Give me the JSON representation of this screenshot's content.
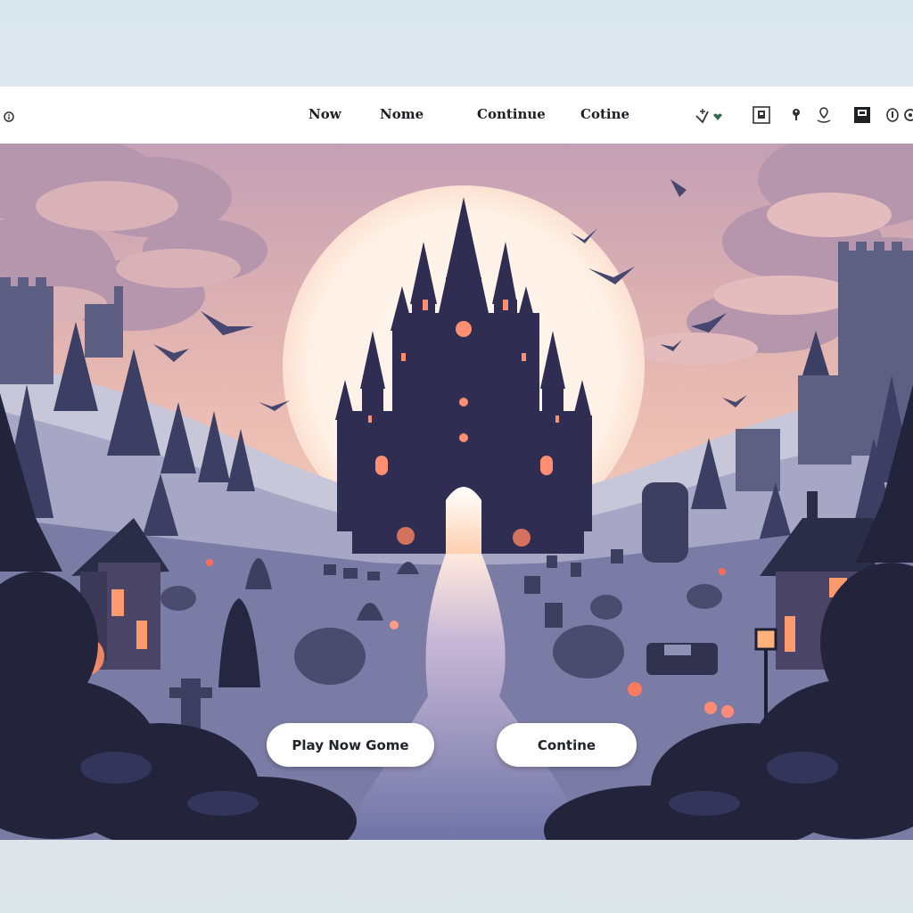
{
  "nav": {
    "items": [
      {
        "label": "Now"
      },
      {
        "label": "Nome"
      },
      {
        "label": "Continue"
      },
      {
        "label": "Cotine"
      }
    ]
  },
  "toolbar": {
    "icons": [
      "info-icon",
      "heart-check-icon",
      "book-icon",
      "pin-icon",
      "location-icon",
      "save-icon",
      "help-icon",
      "settings-icon"
    ]
  },
  "scene": {
    "theme_colors": {
      "sky_top": "#c9a3b0",
      "sky_glow": "#f7cfb6",
      "moon": "#fff4ec",
      "castle": "#2c2b4d",
      "window_glow": "#ff8a6a",
      "ground": "#6e6f95",
      "foreground": "#22233a"
    }
  },
  "buttons": {
    "new_game_label": "Play Now Gome",
    "continue_label": "Contine"
  }
}
